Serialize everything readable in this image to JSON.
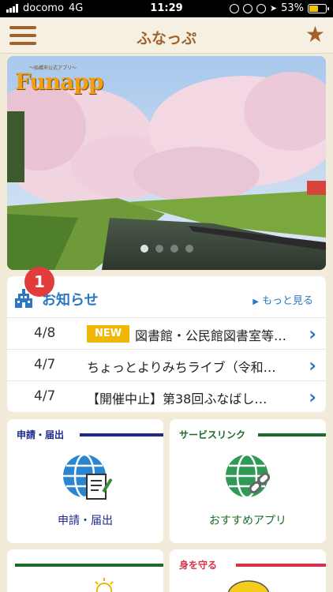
{
  "status_bar": {
    "carrier": "docomo",
    "network": "4G",
    "time": "11:29",
    "battery": "53%",
    "battery_level": 0.53
  },
  "header": {
    "title": "ふなっぷ",
    "menu_icon": "hamburger-menu-icon",
    "favorite_icon": "star-icon"
  },
  "banner": {
    "logo_text": "Funapp",
    "logo_subtitle": "〜船橋市公式アプリ〜",
    "slide_count": 4,
    "active_slide": 1
  },
  "news": {
    "badge": "1",
    "title": "お知らせ",
    "more_label": "もっと見る",
    "items": [
      {
        "date": "4/8",
        "new_label": "NEW",
        "text": "図書館・公民館図書室等…"
      },
      {
        "date": "4/7",
        "text": "ちょっとよりみちライブ（令和…"
      },
      {
        "date": "4/7",
        "text": "【開催中止】第38回ふなばし…"
      }
    ]
  },
  "tiles": [
    {
      "label": "申請・届出",
      "caption": "申請・届出",
      "icon": "globe-document-icon",
      "color": "#1d2a8c",
      "caption_color": "#1d2a8c"
    },
    {
      "label": "サービスリンク",
      "caption": "おすすめアプリ",
      "icon": "globe-link-icon",
      "color": "#1e6a2a",
      "caption_color": "#1e6a2a"
    },
    {
      "label": "",
      "caption": "",
      "icon": "lightbulb-icon",
      "color": "#1e6a2a"
    },
    {
      "label": "身を守る",
      "caption": "",
      "icon": "helmet-icon",
      "color": "#d8324a"
    }
  ],
  "colors": {
    "brand": "#a0622a",
    "link": "#2a78c2",
    "badge": "#e23b3b",
    "new": "#f2b705",
    "background": "#f3ebd9"
  }
}
